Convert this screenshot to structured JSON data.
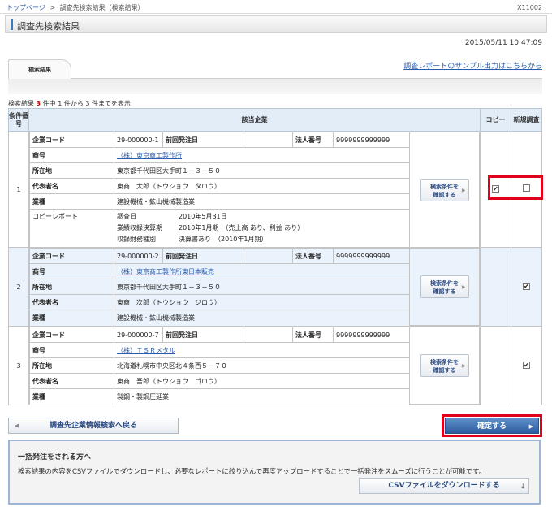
{
  "breadcrumb": {
    "home": "トップページ",
    "sep": ">",
    "current": "調査先検索結果（検索結果）"
  },
  "page_id": "X11002",
  "page_title": "調査先検索結果",
  "datetime": "2015/05/11 10:47:09",
  "tab_label": "検索結果",
  "sample_link": "調査レポートのサンプル出力はこちらから",
  "result_count": {
    "prefix": "検索結果",
    "total": "3",
    "mid": "件中 1 件から 3 件までを表示"
  },
  "headers": {
    "num": "条件番号",
    "company": "該当企業",
    "copy": "コピー",
    "new": "新規調査"
  },
  "labels": {
    "code": "企業コード",
    "prev": "前回発注日",
    "corp": "法人番号",
    "name": "商号",
    "addr": "所在地",
    "rep": "代表者名",
    "industry": "業種",
    "copy_report": "コピーレポート",
    "survey_date": "調査日",
    "fiscal": "業績収録決算期",
    "fin": "収録財務種別"
  },
  "cond_button": {
    "line1": "検索条件を",
    "line2": "確認する"
  },
  "rows": [
    {
      "num": "1",
      "code": "29-000000-1",
      "prev": "",
      "corp": "9999999999999",
      "name": "（株）東京商工製作所",
      "addr": "東京都千代田区大手町１－３－５０",
      "rep": "東商　太郎（トウショウ　タロウ）",
      "industry": "建設機械・鉱山機械製造業",
      "survey_date": "2010年5月31日",
      "fiscal": "2010年1月期　（売上高 あり、利益 あり）",
      "fin": "決算書あり　（2010年1月期）",
      "copy": true,
      "new": false
    },
    {
      "num": "2",
      "code": "29-000000-2",
      "prev": "",
      "corp": "9999999999999",
      "name": "（株）東京商工製作所東日本販売",
      "addr": "東京都千代田区大手町１－３－５０",
      "rep": "東商　次郎（トウショウ　ジロウ）",
      "industry": "建設機械・鉱山機械製造業",
      "new": true
    },
    {
      "num": "3",
      "code": "29-000000-7",
      "prev": "",
      "corp": "9999999999999",
      "name": "（株）ＴＳＲメタル",
      "addr": "北海道札幌市中央区北４条西５－７０",
      "rep": "東商　吾郎（トウショウ　ゴロウ）",
      "industry": "製鋼・製鋼圧延業",
      "new": true
    }
  ],
  "back_button": "調査先企業情報検索へ戻る",
  "confirm_button": "確定する",
  "bulk": {
    "heading": "一括発注をされる方へ",
    "desc": "検索結果の内容をCSVファイルでダウンロードし、必要なレポートに絞り込んで再度アップロードすることで一括発注をスムーズに行うことが可能です。",
    "csv_button": "CSVファイルをダウンロードする"
  },
  "colors": {
    "accent": "#3b78c2",
    "highlight": "#e0001a",
    "link": "#2a5db0"
  }
}
